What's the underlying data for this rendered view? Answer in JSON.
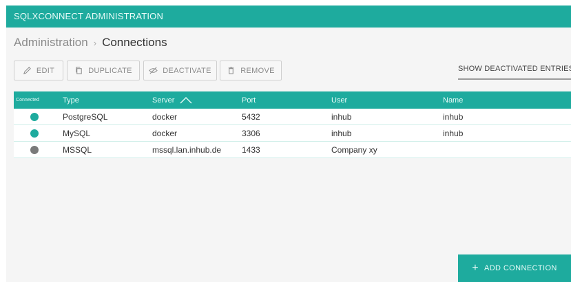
{
  "app": {
    "title": "SQLXCONNECT ADMINISTRATION"
  },
  "breadcrumb": {
    "parent": "Administration",
    "separator": "›",
    "current": "Connections"
  },
  "toolbar": {
    "edit_label": "EDIT",
    "duplicate_label": "DUPLICATE",
    "deactivate_label": "DEACTIVATE",
    "remove_label": "REMOVE",
    "show_deactivated_label": "SHOW DEACTIVATED ENTRIES"
  },
  "table": {
    "columns": {
      "connected": "Connected",
      "type": "Type",
      "server": "Server",
      "port": "Port",
      "user": "User",
      "name": "Name"
    },
    "sort_column": "server",
    "sort_direction": "ascending",
    "rows": [
      {
        "connected": true,
        "status_color": "#1eab9e",
        "type": "PostgreSQL",
        "server": "docker",
        "port": "5432",
        "user": "inhub",
        "name": "inhub"
      },
      {
        "connected": true,
        "status_color": "#1eab9e",
        "type": "MySQL",
        "server": "docker",
        "port": "3306",
        "user": "inhub",
        "name": "inhub"
      },
      {
        "connected": false,
        "status_color": "#7a7a7a",
        "type": "MSSQL",
        "server": "mssql.lan.inhub.de",
        "port": "1433",
        "user": "Company xy",
        "name": ""
      }
    ]
  },
  "fab": {
    "label": "ADD CONNECTION",
    "icon": "plus-icon"
  },
  "colors": {
    "accent": "#1eab9e",
    "inactive": "#7a7a7a",
    "background": "#f5f5f5"
  }
}
